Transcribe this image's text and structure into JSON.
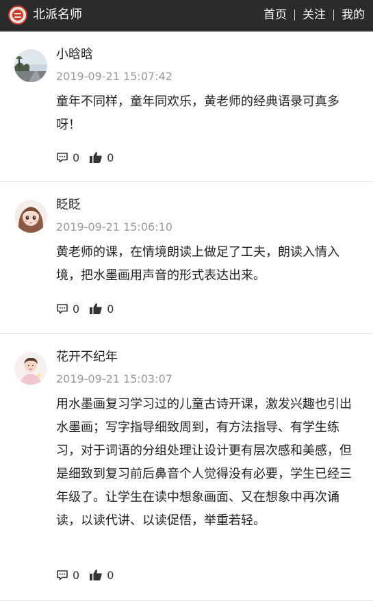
{
  "header": {
    "site_name": "北派名师",
    "logo_icon": "seal-logo-icon",
    "nav": [
      {
        "label": "首页"
      },
      {
        "label": "关注"
      },
      {
        "label": "我的"
      }
    ]
  },
  "comments": [
    {
      "user": "小晗晗",
      "time": "2019-09-21 15:07:42",
      "text": "童年不同样，童年同欢乐，黄老师的经典语录可真多呀！",
      "reply_count": "0",
      "like_count": "0"
    },
    {
      "user": "眨眨",
      "time": "2019-09-21 15:06:10",
      "text": "黄老师的课，在情境朗读上做足了工夫，朗读入情入境，把水墨画用声音的形式表达出来。",
      "reply_count": "0",
      "like_count": "0"
    },
    {
      "user": "花开不纪年",
      "time": "2019-09-21 15:03:07",
      "text": "用水墨画复习学习过的儿童古诗开课，激发兴趣也引出水墨画；写字指导细致周到，有方法指导、有学生练习，对于词语的分组处理让设计更有层次感和美感，但是细致到复习前后鼻音个人觉得没有必要，学生已经三年级了。让学生在读中想象画面、又在想象中再次诵读，以读代讲、以读促悟，举重若轻。",
      "reply_count": "0",
      "like_count": "0"
    }
  ],
  "colors": {
    "header_bg": "#2b2b2b",
    "timestamp": "#9a9a9a",
    "divider": "#e6e6e6",
    "logo_red": "#c93a2e"
  }
}
